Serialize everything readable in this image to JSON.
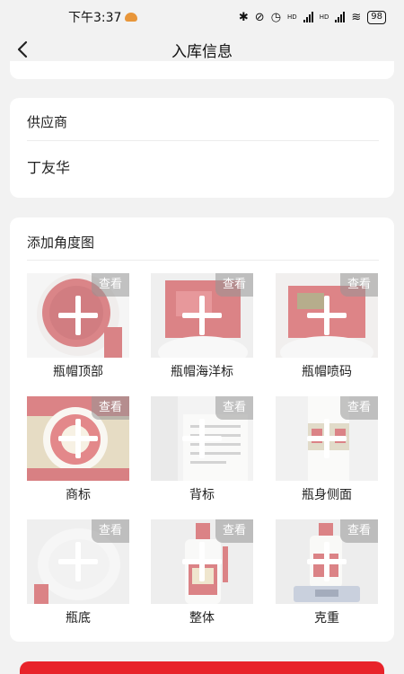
{
  "status_bar": {
    "time": "下午3:37",
    "battery": "98",
    "icons": [
      "bluetooth-icon",
      "mute-icon",
      "alarm-icon",
      "signal-icon",
      "signal-icon",
      "wifi-icon",
      "battery-icon"
    ],
    "network_label_1": "HD",
    "network_label_2": "HD"
  },
  "nav": {
    "title": "入库信息",
    "back_icon": "chevron-left-icon"
  },
  "supplier": {
    "label": "供应商",
    "value": "丁友华"
  },
  "photos": {
    "title": "添加角度图",
    "view_label": "查看",
    "items": [
      {
        "label": "瓶帽顶部",
        "icon": "plus-icon"
      },
      {
        "label": "瓶帽海洋标",
        "icon": "plus-icon"
      },
      {
        "label": "瓶帽喷码",
        "icon": "plus-icon"
      },
      {
        "label": "商标",
        "icon": "plus-icon"
      },
      {
        "label": "背标",
        "icon": "plus-icon"
      },
      {
        "label": "瓶身侧面",
        "icon": "plus-icon"
      },
      {
        "label": "瓶底",
        "icon": "plus-icon"
      },
      {
        "label": "整体",
        "icon": "plus-icon"
      },
      {
        "label": "克重",
        "icon": "plus-icon"
      }
    ]
  },
  "colors": {
    "accent": "#e8232a",
    "background": "#f2f2f2"
  }
}
